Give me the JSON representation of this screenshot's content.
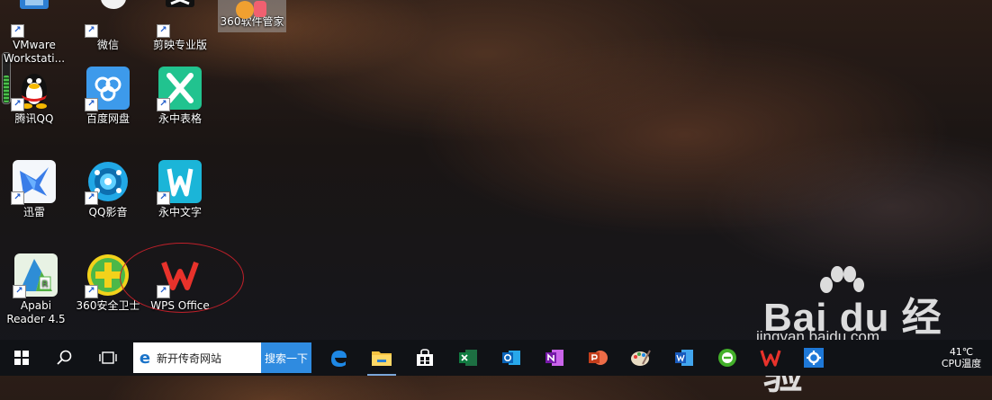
{
  "desktop": {
    "icons": [
      {
        "label": "VMware Workstati...",
        "selected": false
      },
      {
        "label": "微信",
        "selected": false
      },
      {
        "label": "剪映专业版",
        "selected": false
      },
      {
        "label": "360软件管家",
        "selected": true
      },
      {
        "label": "腾讯QQ",
        "selected": false
      },
      {
        "label": "百度网盘",
        "selected": false
      },
      {
        "label": "永中表格",
        "selected": false
      },
      {
        "label": "迅雷",
        "selected": false
      },
      {
        "label": "QQ影音",
        "selected": false
      },
      {
        "label": "永中文字",
        "selected": false
      },
      {
        "label": "Apabi Reader 4.5",
        "selected": false
      },
      {
        "label": "360安全卫士",
        "selected": false
      },
      {
        "label": "WPS Office",
        "selected": false
      }
    ],
    "shortcut_glyph": "↗",
    "annotation_color": "#c0202a"
  },
  "watermark": {
    "logo": "Bai du 经验",
    "url": "jingyan.baidu.com"
  },
  "taskbar": {
    "search_placeholder": "新开传奇网站",
    "search_button": "搜索一下",
    "apps": [
      "start-icon",
      "search-icon",
      "task-view-icon",
      "edge-icon",
      "file-explorer-icon",
      "store-icon",
      "excel-icon",
      "outlook-icon",
      "onenote-icon",
      "powerpoint-icon",
      "paint-icon",
      "word-icon",
      "browser-green-icon",
      "wps-icon",
      "settings-icon"
    ],
    "tray": {
      "temperature": "41℃",
      "temp_label": "CPU温度"
    }
  }
}
